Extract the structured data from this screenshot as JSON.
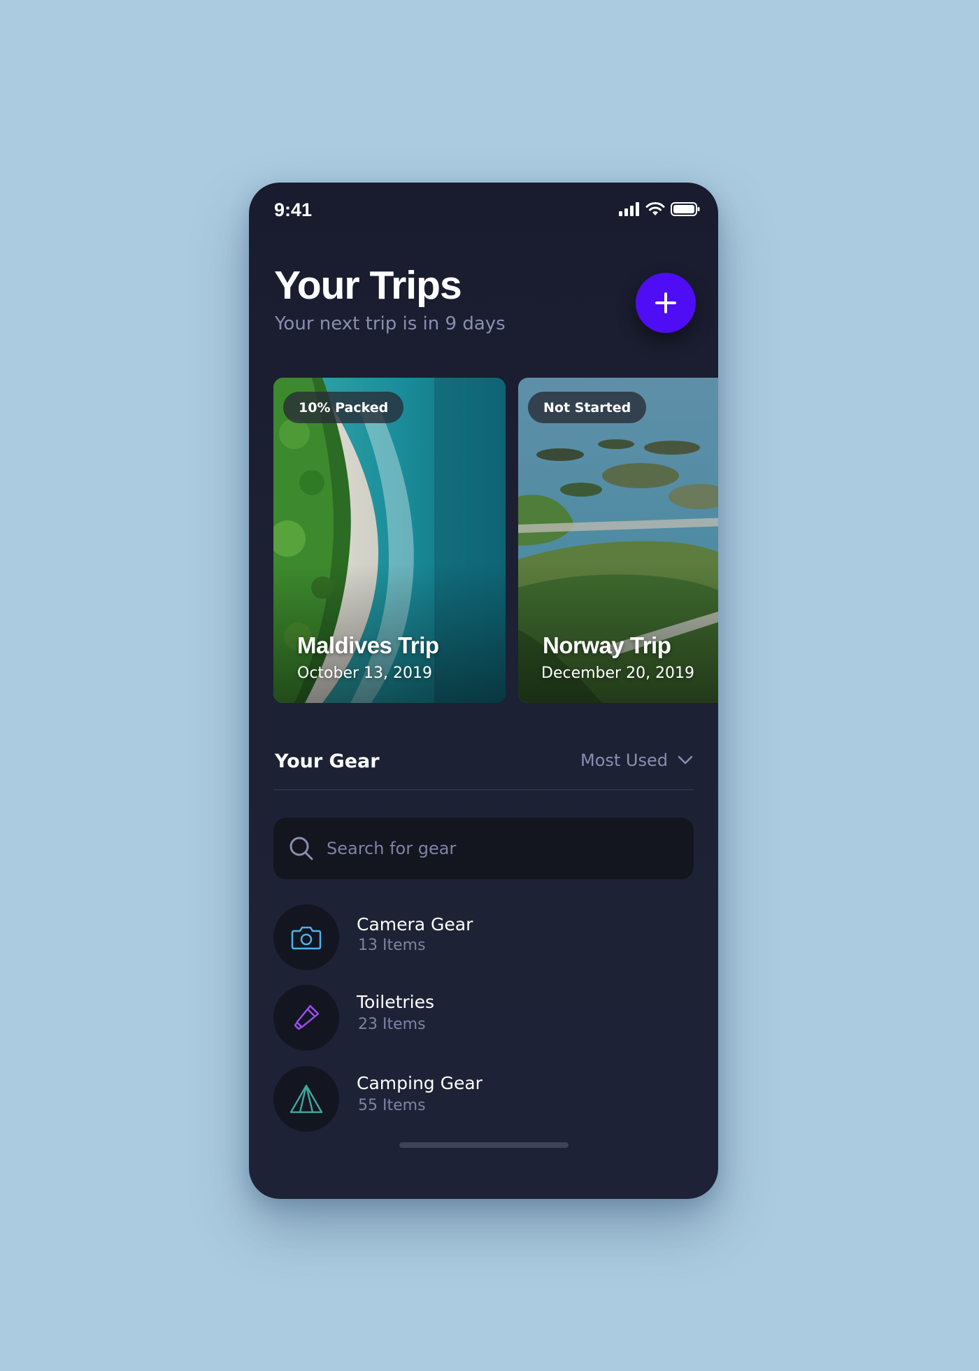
{
  "status_bar": {
    "time": "9:41"
  },
  "header": {
    "title": "Your Trips",
    "subtitle": "Your next trip is in 9 days",
    "add_icon": "plus-icon"
  },
  "trips": [
    {
      "badge": "10% Packed",
      "name": "Maldives Trip",
      "date": "October 13, 2019"
    },
    {
      "badge": "Not Started",
      "name": "Norway Trip",
      "date": "December 20, 2019"
    }
  ],
  "gear": {
    "heading": "Your Gear",
    "sort_label": "Most Used",
    "search_placeholder": "Search for gear",
    "categories": [
      {
        "name": "Camera Gear",
        "count": "13 Items",
        "icon": "camera-icon",
        "color": "#4fb3e6"
      },
      {
        "name": "Toiletries",
        "count": "23 Items",
        "icon": "toothpaste-icon",
        "color": "#9a4cf0"
      },
      {
        "name": "Camping Gear",
        "count": "55 Items",
        "icon": "tent-icon",
        "color": "#3fa59a"
      }
    ]
  },
  "colors": {
    "accent": "#4e0df5",
    "background": "#1d2134",
    "page_background": "#abcbe0",
    "muted_text": "#8a8fb0"
  }
}
